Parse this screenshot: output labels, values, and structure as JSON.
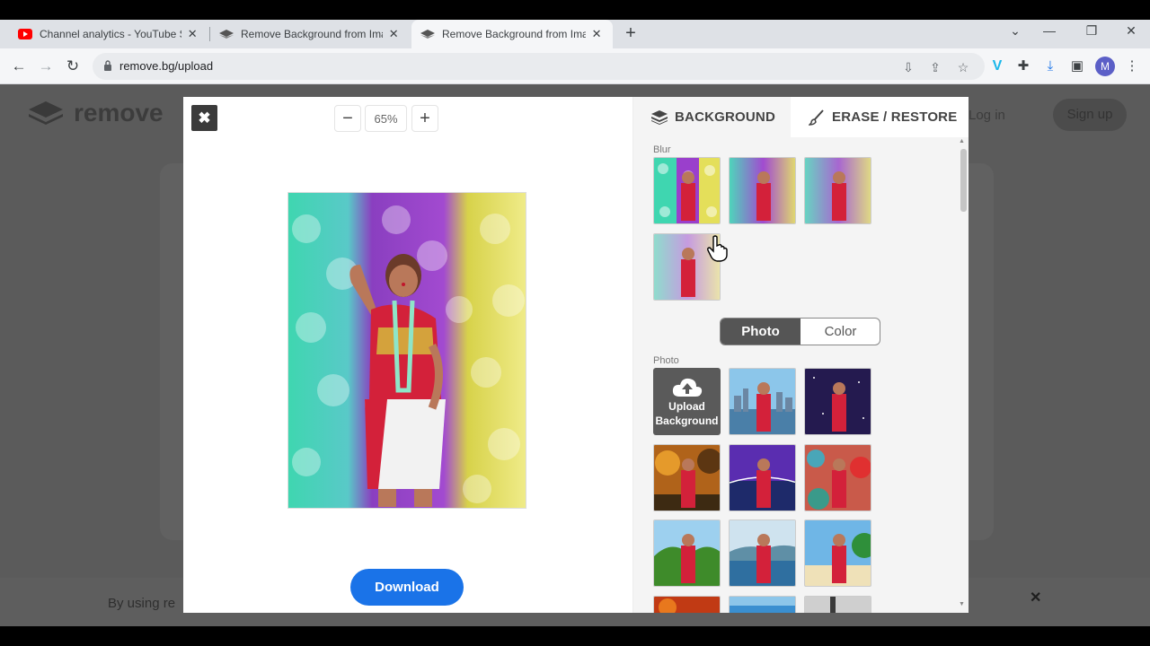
{
  "browser": {
    "tabs": [
      {
        "title": "Channel analytics - YouTube Studio",
        "icon": "youtube-icon",
        "active": false
      },
      {
        "title": "Remove Background from Image",
        "icon": "removebg-icon",
        "active": false
      },
      {
        "title": "Remove Background from Image",
        "icon": "removebg-icon",
        "active": true
      }
    ],
    "close_tab_glyph": "✕",
    "new_tab_glyph": "+",
    "window_controls": {
      "menu": "⌄",
      "minimize": "—",
      "restore": "❐",
      "close": "✕"
    },
    "nav": {
      "back": "←",
      "forward": "→",
      "reload": "↻"
    },
    "url": "remove.bg/upload",
    "profile_initial": "M",
    "icons": [
      "install-icon",
      "share-icon",
      "star-icon",
      "vimeo-icon",
      "extensions-icon",
      "download-icon",
      "sidebar-icon",
      "menu-icon"
    ],
    "accent": "#1a73e8"
  },
  "page": {
    "logo_text": "remove",
    "login": "Log in",
    "signup": "Sign up",
    "cookie_text": "By using re",
    "cookie_close": "✕"
  },
  "modal": {
    "close_glyph": "✖",
    "zoom": {
      "minus": "−",
      "value": "65%",
      "plus": "+"
    },
    "download_label": "Download",
    "tabs": {
      "background": "BACKGROUND",
      "erase_restore": "ERASE / RESTORE"
    },
    "blur_label": "Blur",
    "toggle": {
      "photo": "Photo",
      "color": "Color",
      "selected": "Photo"
    },
    "photo_label": "Photo",
    "upload_background": {
      "line1": "Upload",
      "line2": "Background"
    },
    "blur_thumbs": [
      "blur-strong",
      "blur-medium",
      "blur-light",
      "blur-selected"
    ],
    "photo_thumbs": [
      "city-skyline",
      "night-sky",
      "autumn-forest",
      "sunset-bridge",
      "graffiti-wall",
      "green-hills",
      "blue-lake",
      "tropical-beach",
      "red-foliage",
      "sky-blue",
      "dark-tree"
    ]
  }
}
